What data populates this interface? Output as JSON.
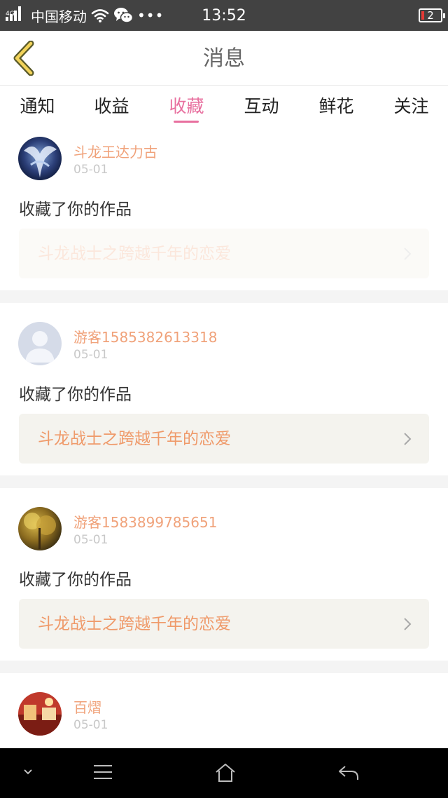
{
  "status": {
    "network": "4G",
    "carrier": "中国移动",
    "more": "•••",
    "time": "13:52",
    "battery": "2"
  },
  "header": {
    "title": "消息"
  },
  "tabs": [
    {
      "label": "通知"
    },
    {
      "label": "收益"
    },
    {
      "label": "收藏",
      "active": true
    },
    {
      "label": "互动"
    },
    {
      "label": "鲜花"
    },
    {
      "label": "关注"
    }
  ],
  "feed": [
    {
      "user": "斗龙王达力古",
      "date": "05-01",
      "action": "收藏了你的作品",
      "work": "斗龙战士之跨越千年的恋爱",
      "avatar": "dragon-avatar"
    },
    {
      "user": "游客1585382613318",
      "date": "05-01",
      "action": "收藏了你的作品",
      "work": "斗龙战士之跨越千年的恋爱",
      "avatar": "default-avatar"
    },
    {
      "user": "游客1583899785651",
      "date": "05-01",
      "action": "收藏了你的作品",
      "work": "斗龙战士之跨越千年的恋爱",
      "avatar": "tree-avatar"
    },
    {
      "user": "百熠",
      "date": "05-01",
      "avatar": "red-avatar"
    }
  ],
  "colors": {
    "accent": "#e8709f",
    "username": "#f0a27a",
    "work_title": "#ef9a6a",
    "work_bg": "#f4f3ee",
    "status_bar": "#424242"
  },
  "icons": {
    "back": "chevron-left-icon",
    "nav": [
      "chevron-down-icon",
      "menu-icon",
      "home-icon",
      "back-arrow-icon"
    ]
  }
}
